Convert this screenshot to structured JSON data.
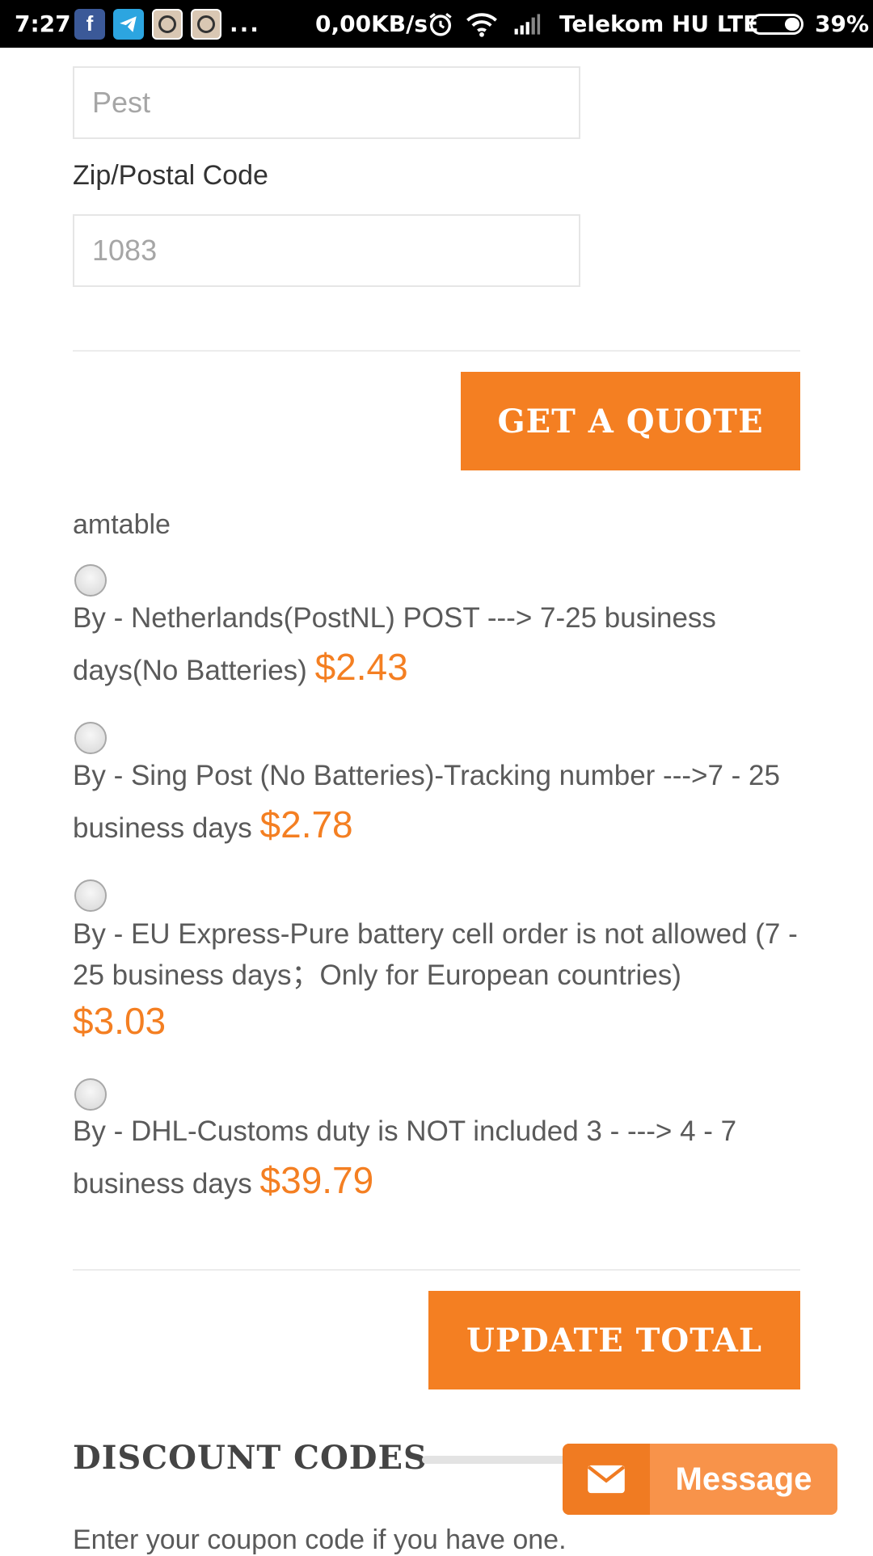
{
  "status_bar": {
    "time": "7:27",
    "more": "...",
    "speed": "0,00KB/s",
    "carrier": "Telekom HU LTE",
    "battery": "39%",
    "icons": [
      "facebook-icon",
      "telegram-icon",
      "camera-icon",
      "camera-icon",
      "alarm-icon",
      "wifi-icon",
      "signal-icon",
      "battery-icon"
    ]
  },
  "form": {
    "city_value": "Pest",
    "zip_label": "Zip/Postal Code",
    "zip_value": "1083",
    "quote_button": "GET A QUOTE",
    "table_label": "amtable"
  },
  "shipping_options": [
    {
      "text": "By - Netherlands(PostNL) POST ---> 7-25 business days(No Batteries)",
      "price": "$2.43"
    },
    {
      "text": "By - Sing Post (No Batteries)-Tracking number --->7 - 25 business days",
      "price": "$2.78"
    },
    {
      "text": "By - EU Express-Pure battery cell order is not allowed (7 - 25 business days；Only for European countries)",
      "price": "$3.03"
    },
    {
      "text": "By - DHL-Customs duty is NOT included 3 - ---> 4 - 7 business days",
      "price": "$39.79"
    }
  ],
  "update_button": "UPDATE TOTAL",
  "discount": {
    "heading": "DISCOUNT CODES",
    "helper": "Enter your coupon code if you have one."
  },
  "message_button": {
    "label": "Message",
    "icon": "envelope-icon"
  },
  "colors": {
    "accent": "#f47f22",
    "status_bar": "#000000"
  }
}
